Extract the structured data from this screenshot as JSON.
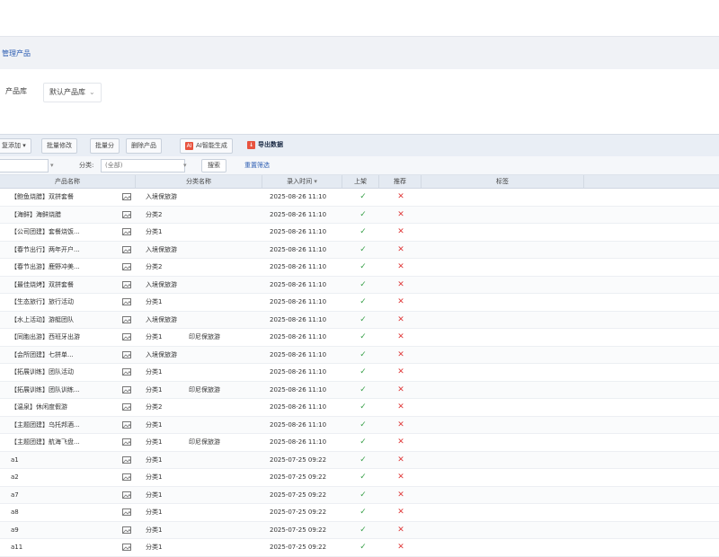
{
  "header": {
    "title": "管理产品"
  },
  "tabs": [
    {
      "label": "产品库"
    },
    {
      "label": "默认产品库",
      "chevron": "⌄"
    }
  ],
  "toolbar": {
    "buttons": [
      {
        "label": "复添加 ▾"
      },
      {
        "label": "批量修改"
      },
      {
        "label": "批量分"
      },
      {
        "label": "删除产品"
      },
      {
        "label": "AI智能生成"
      },
      {
        "label": "导出数据"
      }
    ]
  },
  "filters": {
    "keyword": "",
    "category_label": "分类:",
    "category_value": "(全部)",
    "search_label": "搜索",
    "reset_label": "重置筛选"
  },
  "columns": [
    "产品名称",
    "分类名称",
    "录入时间",
    "上架",
    "推荐",
    "标签"
  ],
  "icons": {
    "image": "image-icon",
    "check": "✓",
    "cross": "✕"
  },
  "colors": {
    "check": "#3aa04a",
    "cross": "#e03a3a",
    "link": "#2f5fb3",
    "toolbar": "#e9eef5"
  },
  "rows": [
    {
      "name": "【鲍鱼烧腊】双拼套餐",
      "cat": "入境保旅游",
      "tag": "",
      "time": "2025-08-26 11:10",
      "on": "✓",
      "rec": "✕"
    },
    {
      "name": "【海鲜】海鲜烧腊",
      "cat": "分类2",
      "tag": "",
      "time": "2025-08-26 11:10",
      "on": "✓",
      "rec": "✕"
    },
    {
      "name": "【公司团建】套餐烧饭...",
      "cat": "分类1",
      "tag": "",
      "time": "2025-08-26 11:10",
      "on": "✓",
      "rec": "✕"
    },
    {
      "name": "【春节出行】两年开户...",
      "cat": "入境保旅游",
      "tag": "",
      "time": "2025-08-26 11:10",
      "on": "✓",
      "rec": "✕"
    },
    {
      "name": "【春节出游】鹿野冲美...",
      "cat": "分类2",
      "tag": "",
      "time": "2025-08-26 11:10",
      "on": "✓",
      "rec": "✕"
    },
    {
      "name": "【最佳烧烤】双拼套餐",
      "cat": "入境保旅游",
      "tag": "",
      "time": "2025-08-26 11:10",
      "on": "✓",
      "rec": "✕"
    },
    {
      "name": "【生态旅行】旅行活动",
      "cat": "分类1",
      "tag": "",
      "time": "2025-08-26 11:10",
      "on": "✓",
      "rec": "✕"
    },
    {
      "name": "【水上活动】游艇团队",
      "cat": "入境保旅游",
      "tag": "",
      "time": "2025-08-26 11:10",
      "on": "✓",
      "rec": "✕"
    },
    {
      "name": "【同胞出游】西班牙出游",
      "cat": "分类1",
      "tag": "印尼保旅游",
      "time": "2025-08-26 11:10",
      "on": "✓",
      "rec": "✕"
    },
    {
      "name": "【会所团建】七拼单...",
      "cat": "入境保旅游",
      "tag": "",
      "time": "2025-08-26 11:10",
      "on": "✓",
      "rec": "✕"
    },
    {
      "name": "【拓展训练】团队活动",
      "cat": "分类1",
      "tag": "",
      "time": "2025-08-26 11:10",
      "on": "✓",
      "rec": "✕"
    },
    {
      "name": "【拓展训练】团队训练...",
      "cat": "分类1",
      "tag": "印尼保旅游",
      "time": "2025-08-26 11:10",
      "on": "✓",
      "rec": "✕"
    },
    {
      "name": "【温泉】休闲度假游",
      "cat": "分类2",
      "tag": "",
      "time": "2025-08-26 11:10",
      "on": "✓",
      "rec": "✕"
    },
    {
      "name": "【主题团建】乌托邦酒...",
      "cat": "分类1",
      "tag": "",
      "time": "2025-08-26 11:10",
      "on": "✓",
      "rec": "✕"
    },
    {
      "name": "【主题团建】航海飞盘...",
      "cat": "分类1",
      "tag": "印尼保旅游",
      "time": "2025-08-26 11:10",
      "on": "✓",
      "rec": "✕"
    },
    {
      "name": "a1",
      "cat": "分类1",
      "tag": "",
      "time": "2025-07-25 09:22",
      "on": "✓",
      "rec": "✕"
    },
    {
      "name": "a2",
      "cat": "分类1",
      "tag": "",
      "time": "2025-07-25 09:22",
      "on": "✓",
      "rec": "✕"
    },
    {
      "name": "a7",
      "cat": "分类1",
      "tag": "",
      "time": "2025-07-25 09:22",
      "on": "✓",
      "rec": "✕"
    },
    {
      "name": "a8",
      "cat": "分类1",
      "tag": "",
      "time": "2025-07-25 09:22",
      "on": "✓",
      "rec": "✕"
    },
    {
      "name": "a9",
      "cat": "分类1",
      "tag": "",
      "time": "2025-07-25 09:22",
      "on": "✓",
      "rec": "✕"
    },
    {
      "name": "a11",
      "cat": "分类1",
      "tag": "",
      "time": "2025-07-25 09:22",
      "on": "✓",
      "rec": "✕"
    }
  ]
}
